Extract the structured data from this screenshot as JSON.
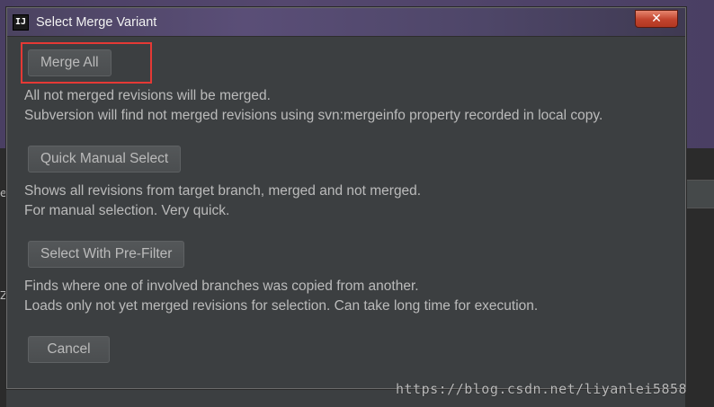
{
  "window": {
    "app_icon_text": "IJ",
    "title": "Select Merge Variant",
    "close_label": "✕"
  },
  "options": [
    {
      "button_label": "Merge All",
      "description_line1": "All not merged revisions will be merged.",
      "description_line2": "Subversion will find not merged revisions using svn:mergeinfo property recorded in local copy."
    },
    {
      "button_label": "Quick Manual Select",
      "description_line1": "Shows all revisions from target branch, merged and not merged.",
      "description_line2": "For manual selection. Very quick."
    },
    {
      "button_label": "Select With Pre-Filter",
      "description_line1": "Finds where one of involved branches was copied from another.",
      "description_line2": "Loads only not yet merged revisions for selection. Can take long time for execution."
    }
  ],
  "cancel_label": "Cancel",
  "background": {
    "left_glyph_1": "e",
    "left_glyph_2": "Z"
  },
  "watermark": "https://blog.csdn.net/liyanlei5858",
  "colors": {
    "highlight": "#e53935",
    "dialog_bg": "#3c3f41",
    "text": "#bbbbbb"
  }
}
